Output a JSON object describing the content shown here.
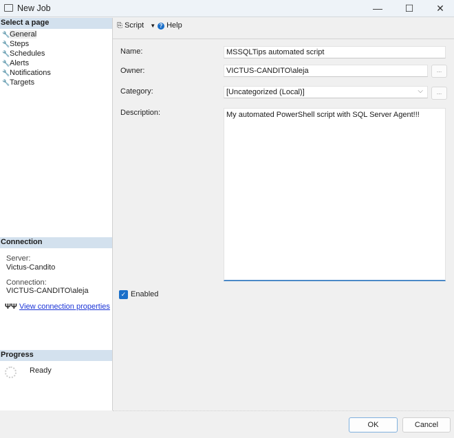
{
  "window": {
    "title": "New Job",
    "minimize": "—",
    "maximize": "☐",
    "close": "✕"
  },
  "left": {
    "select_header": "Select a page",
    "pages": [
      {
        "label": "General"
      },
      {
        "label": "Steps"
      },
      {
        "label": "Schedules"
      },
      {
        "label": "Alerts"
      },
      {
        "label": "Notifications"
      },
      {
        "label": "Targets"
      }
    ],
    "connection_header": "Connection",
    "server_label": "Server:",
    "server_value": "Victus-Candito",
    "connection_label": "Connection:",
    "connection_value": "VICTUS-CANDITO\\aleja",
    "view_props": "View connection properties",
    "progress_header": "Progress",
    "progress_status": "Ready"
  },
  "toolbar": {
    "script": "Script",
    "help": "Help"
  },
  "form": {
    "name_label": "Name:",
    "name_value": "MSSQLTips automated script",
    "owner_label": "Owner:",
    "owner_value": "VICTUS-CANDITO\\aleja",
    "category_label": "Category:",
    "category_value": "[Uncategorized (Local)]",
    "description_label": "Description:",
    "description_value": "My automated PowerShell script with SQL Server Agent!!!",
    "browse": "...",
    "enabled_label": "Enabled",
    "enabled": true
  },
  "buttons": {
    "ok": "OK",
    "cancel": "Cancel"
  },
  "colors": {
    "accent": "#1a6fc9",
    "header_bg": "#d3e1ee"
  }
}
